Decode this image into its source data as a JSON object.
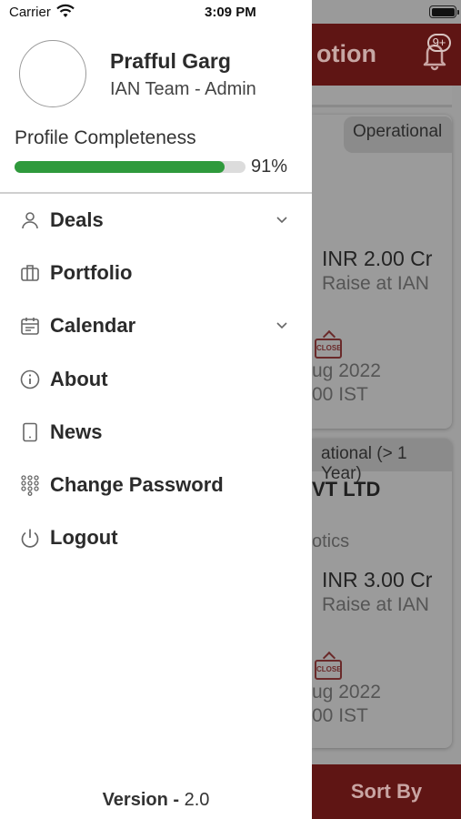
{
  "status_bar": {
    "carrier": "Carrier",
    "time": "3:09 PM"
  },
  "background": {
    "header_title_fragment": "otion",
    "notification_badge": "9+",
    "cards": [
      {
        "tag": "Operational",
        "amount": "INR 2.00 Cr",
        "raise_label": "Raise at IAN",
        "close_badge": "CLOSE",
        "date": "ug 2022",
        "time": "00 IST"
      },
      {
        "tag": "ational (> 1 Year)",
        "company": "VT LTD",
        "sector": "otics",
        "amount": "INR 3.00 Cr",
        "raise_label": "Raise at IAN",
        "close_badge": "CLOSE",
        "date": "ug 2022",
        "time": "00 IST"
      }
    ],
    "sort_label": "Sort By"
  },
  "profile": {
    "name": "Prafful Garg",
    "role": "IAN Team - Admin",
    "completeness_label": "Profile Completeness",
    "completeness_pct": 91,
    "completeness_text": "91%"
  },
  "menu": [
    {
      "label": "Deals",
      "icon": "person-icon",
      "expandable": true
    },
    {
      "label": "Portfolio",
      "icon": "briefcase-icon",
      "expandable": false
    },
    {
      "label": "Calendar",
      "icon": "calendar-icon",
      "expandable": true
    },
    {
      "label": "About",
      "icon": "info-icon",
      "expandable": false
    },
    {
      "label": "News",
      "icon": "phone-icon",
      "expandable": false
    },
    {
      "label": "Change Password",
      "icon": "keypad-icon",
      "expandable": false
    },
    {
      "label": "Logout",
      "icon": "power-icon",
      "expandable": false
    }
  ],
  "footer": {
    "version_label": "Version -",
    "version_value": "2.0"
  },
  "colors": {
    "brand": "#8b1d1b",
    "progress": "#2f9a3c",
    "drawer_bg": "#ffffff"
  }
}
